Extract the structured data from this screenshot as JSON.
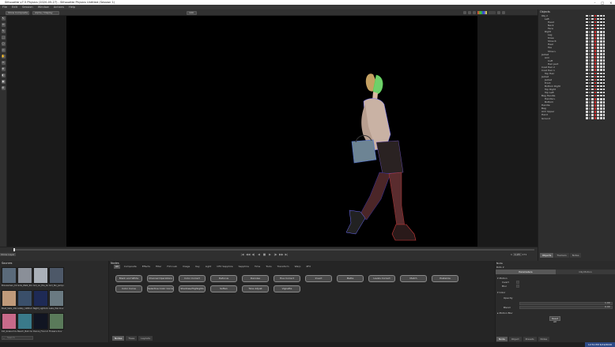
{
  "window": {
    "title": "Silhouette v7.5 Physics (2020-05-27) - Silhouette Physics Untitled (Session 1)",
    "minimize": "–",
    "maximize": "□",
    "close": "×"
  },
  "menu": {
    "items": [
      "File",
      "Edit",
      "Session",
      "Window",
      "Actions",
      "Help"
    ]
  },
  "toolbar": {
    "view_mode": "Show Composite",
    "view_sel": "Alpha / Display",
    "zoom": "100"
  },
  "tools": [
    "↖",
    "↔",
    "✎",
    "⬚",
    "○",
    "◇",
    "✋",
    "✂",
    "⊕",
    "◐",
    "▣",
    "⊞"
  ],
  "timeline": {
    "layer_label": "Show Layer",
    "frame": "1",
    "counter": "1.23",
    "end": "171",
    "playback": [
      "|◀",
      "◀◀",
      "◀|",
      "◀",
      "■",
      "▶",
      "|▶",
      "▶▶",
      "▶|"
    ]
  },
  "objects": {
    "header": "Objects",
    "rows": [
      {
        "name": "Obj 2",
        "indent": 1
      },
      {
        "name": "Left",
        "indent": 2
      },
      {
        "name": "Head",
        "indent": 3
      },
      {
        "name": "Neck",
        "indent": 3
      },
      {
        "name": "Face",
        "indent": 3
      },
      {
        "name": "Right",
        "indent": 2
      },
      {
        "name": "Leg",
        "indent": 3
      },
      {
        "name": "Knee",
        "indent": 3
      },
      {
        "name": "Shoe R",
        "indent": 3
      },
      {
        "name": "Heel",
        "indent": 3
      },
      {
        "name": "Toe",
        "indent": 3
      },
      {
        "name": "Shoe L",
        "indent": 3
      },
      {
        "name": "Jacket",
        "indent": 1
      },
      {
        "name": "Arm",
        "indent": 2
      },
      {
        "name": "Cuff",
        "indent": 3
      },
      {
        "name": "Hair part",
        "indent": 3
      },
      {
        "name": "Coat Hair 2",
        "indent": 1
      },
      {
        "name": "Coat Hair 1",
        "indent": 1
      },
      {
        "name": "Top Hair",
        "indent": 2
      },
      {
        "name": "Jacket",
        "indent": 1
      },
      {
        "name": "Jacket",
        "indent": 2
      },
      {
        "name": "Front",
        "indent": 2
      },
      {
        "name": "Bottom Right",
        "indent": 2
      },
      {
        "name": "Top Right",
        "indent": 2
      },
      {
        "name": "Top Left",
        "indent": 2
      },
      {
        "name": "Bag Handle",
        "indent": 1
      },
      {
        "name": "Handle L",
        "indent": 2
      },
      {
        "name": "Bottom",
        "indent": 2
      },
      {
        "name": "Handle",
        "indent": 1
      },
      {
        "name": "Bag",
        "indent": 1
      },
      {
        "name": "Arm Upper",
        "indent": 1
      },
      {
        "name": "Hand",
        "indent": 1
      },
      {
        "name": "Ground",
        "indent": 1
      }
    ]
  },
  "right_tabs": [
    "Objects",
    "Trackers",
    "Notes"
  ],
  "sources": {
    "header": "Sources",
    "thumbs": [
      {
        "label": "Bronzeman_1920...mov",
        "color": "#5a6a7a"
      },
      {
        "label": "Girls_Walk_Ski.mov",
        "color": "#8a8f98"
      },
      {
        "label": "Girl_on_the_boat.mov",
        "color": "#aab0b8"
      },
      {
        "label": "Girl_Ski_Jump.mov",
        "color": "#4d5868"
      },
      {
        "label": "Boat_Sails_1920...mov",
        "color": "#c09a7a"
      },
      {
        "label": "Lobby_1280.mov",
        "color": "#3a4f6a"
      },
      {
        "label": "Night_Light.mov",
        "color": "#1e2a55"
      },
      {
        "label": "Lake_Pier.mov",
        "color": "#6a7a82"
      },
      {
        "label": "Kid_Grass.mov",
        "color": "#c86a8a"
      },
      {
        "label": "Beach_Ball.mov",
        "color": "#3a7a8a"
      },
      {
        "label": "Dance_Floor.mov",
        "color": "#111522"
      },
      {
        "label": "Flowers.mov",
        "color": "#5a7a5a"
      }
    ],
    "search_placeholder": "Search"
  },
  "nodes": {
    "header": "Nodes",
    "tabs": [
      "All",
      "Composite",
      "Effects",
      "Filter",
      "Film Lab",
      "Image",
      "Key",
      "Light",
      "OFX Sapphire",
      "Sapphire",
      "Time",
      "Tools",
      "Transform",
      "Warp",
      "ZFX"
    ],
    "buttons_row1": [
      "Black and White",
      "Channel Operations",
      "Color Correct",
      "Defocus",
      "Denoise",
      "Hue Correct",
      "Invert",
      "Matte",
      "Levels Correct",
      "Match",
      "Posterize"
    ],
    "buttons_row2": [
      "Color Curve",
      "Selective Color Correct",
      "Shadows/Highlights",
      "Soften",
      "Tone Adjust",
      "Vignette"
    ],
    "bottom_tabs": [
      "Nodes",
      "Trees",
      "Layouts"
    ]
  },
  "properties": {
    "header": "Node",
    "sub": "Roto 2",
    "tabs": [
      "Parameters",
      "Obj Motion"
    ],
    "motion_section": "Motion",
    "motion_rows": [
      "Invert",
      "Blur"
    ],
    "color_section": "Color",
    "opacity_label": "Opacity",
    "opacity_value": "1.00",
    "blend_label": "Blend",
    "blend_value": "0.00",
    "blur_section": "Motion Blur",
    "reset_label": "Reset All",
    "bottom_tabs": [
      "Node",
      "Object",
      "Presets",
      "Notes"
    ]
  },
  "status": {
    "clock": "12:51 PM  6/19/2020"
  }
}
